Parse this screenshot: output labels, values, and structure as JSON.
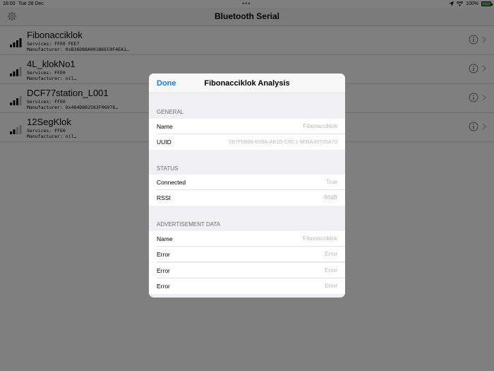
{
  "status_bar": {
    "time": "16:00",
    "date": "Tue 28 Dec",
    "battery": "100%",
    "more_dots": "•••",
    "icons": [
      "location-arrow-icon",
      "wifi-icon",
      "battery-icon"
    ]
  },
  "nav": {
    "title": "Bluetooth Serial",
    "settings_icon": "gear-icon"
  },
  "devices": [
    {
      "name": "Fibonacciklok",
      "services": "Services: FFE0 FEE7",
      "manufacturer": "Manufacturer: 0xB36D88A001B6EC0F4EA1…",
      "signal_bars": 4
    },
    {
      "name": "4L_klokNo1",
      "services": "Services: FFE0",
      "manufacturer": "Manufacturer: nil…",
      "signal_bars": 3
    },
    {
      "name": "DCF77station_L001",
      "services": "Services: FFE0",
      "manufacturer": "Manufacturer: 0x484D882583F06976…",
      "signal_bars": 3
    },
    {
      "name": "12SegKlok",
      "services": "Services: FFE0",
      "manufacturer": "Manufacturer: nil…",
      "signal_bars": 2
    }
  ],
  "modal": {
    "done_label": "Done",
    "title": "Fibonacciklok Analysis",
    "sections": {
      "general": {
        "header": "GENERAL",
        "rows": [
          {
            "label": "Name",
            "value": "Fibonacciklok"
          },
          {
            "label": "UUID",
            "value": "057F0B68-659A-A81D-C6C1-9EBA39705A70"
          }
        ]
      },
      "status": {
        "header": "STATUS",
        "rows": [
          {
            "label": "Connected",
            "value": "True"
          },
          {
            "label": "RSSI",
            "value": "-66dB"
          }
        ]
      },
      "advertisement": {
        "header": "ADVERTISEMENT DATA",
        "rows": [
          {
            "label": "Name",
            "value": "Fibonacciklok"
          },
          {
            "label": "Error",
            "value": "Error"
          },
          {
            "label": "Error",
            "value": "Error"
          },
          {
            "label": "Error",
            "value": "Error"
          }
        ]
      }
    }
  },
  "colors": {
    "accent": "#1a7cf5",
    "battery": "#32c846",
    "dim_overlay": "rgba(0,0,0,0.5)"
  }
}
